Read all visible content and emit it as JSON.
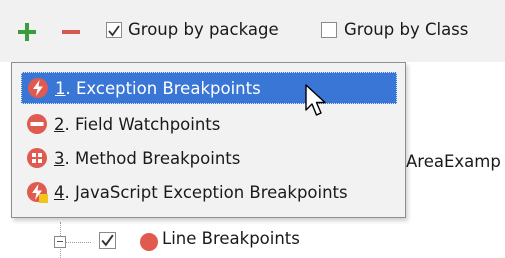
{
  "toolbar": {
    "add_icon": "plus-icon",
    "remove_icon": "minus-icon",
    "group_by_package": {
      "label": "Group by package",
      "checked": true
    },
    "group_by_class": {
      "label": "Group by Class",
      "checked": false
    }
  },
  "menu": {
    "items": [
      {
        "mnemonic": "1",
        "label": ". Exception Breakpoints",
        "icon": "exception-breakpoint-icon",
        "selected": true
      },
      {
        "mnemonic": "2",
        "label": ". Field Watchpoints",
        "icon": "field-watchpoint-icon",
        "selected": false
      },
      {
        "mnemonic": "3",
        "label": ". Method Breakpoints",
        "icon": "method-breakpoint-icon",
        "selected": false
      },
      {
        "mnemonic": "4",
        "label": ". JavaScript Exception Breakpoints",
        "icon": "javascript-exception-breakpoint-icon",
        "selected": false
      }
    ]
  },
  "tree": {
    "partial_text": "AreaExamp",
    "line_breakpoints": {
      "label": "Line Breakpoints",
      "checked": true,
      "icon": "breakpoint-dot-icon"
    }
  },
  "colors": {
    "selection": "#3a76d6",
    "add_green": "#3d9a3d",
    "remove_red": "#d9534f",
    "breakpoint_red": "#e05a4f"
  }
}
